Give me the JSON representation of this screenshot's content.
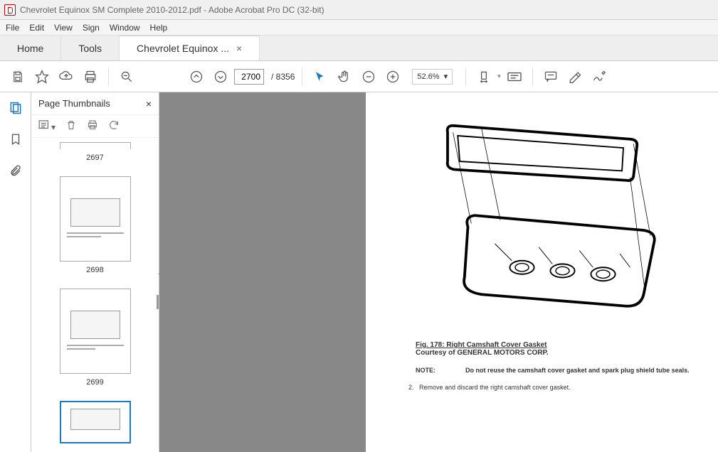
{
  "titlebar": {
    "text": "Chevrolet Equinox SM Complete 2010-2012.pdf - Adobe Acrobat Pro DC (32-bit)"
  },
  "menubar": {
    "file": "File",
    "edit": "Edit",
    "view": "View",
    "sign": "Sign",
    "window": "Window",
    "help": "Help"
  },
  "tabs": {
    "home": "Home",
    "tools": "Tools",
    "doc": "Chevrolet Equinox ..."
  },
  "toolbar": {
    "current_page": "2700",
    "total_pages": "/ 8356",
    "zoom": "52.6%"
  },
  "thumbs": {
    "title": "Page Thumbnails",
    "items": [
      {
        "label": "2697"
      },
      {
        "label": "2698"
      },
      {
        "label": "2699"
      }
    ]
  },
  "document": {
    "fig_title": "Fig. 178: Right Camshaft Cover Gasket",
    "courtesy": "Courtesy of GENERAL MOTORS CORP.",
    "note_label": "NOTE:",
    "note_text": "Do not reuse the camshaft cover gasket and spark plug shield tube seals.",
    "step_num": "2.",
    "step_text": "Remove and discard the right camshaft cover gasket."
  }
}
